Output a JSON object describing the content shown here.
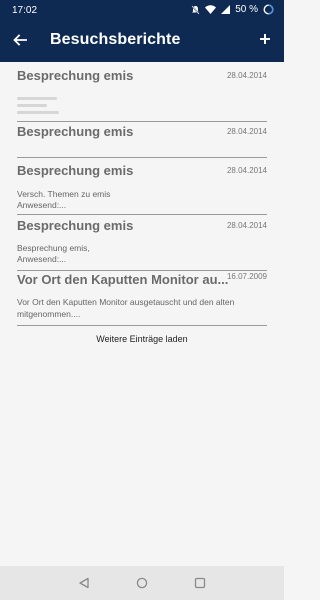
{
  "status_bar": {
    "time": "17:02",
    "battery": "50 %"
  },
  "app_bar": {
    "title": "Besuchsberichte",
    "back_icon": "arrow-left-icon",
    "add_icon": "plus-icon"
  },
  "reports": [
    {
      "title": "Besprechung emis",
      "date": "28.04.2014",
      "description_line1": "",
      "description_line2": ""
    },
    {
      "title": "Besprechung emis",
      "date": "28.04.2014",
      "description_line1": "",
      "description_line2": ""
    },
    {
      "title": "Besprechung emis",
      "date": "28.04.2014",
      "description_line1": "Versch. Themen zu emis",
      "description_line2": "Anwesend:..."
    },
    {
      "title": "Besprechung emis",
      "date": "28.04.2014",
      "description_line1": "Besprechung emis,",
      "description_line2": "Anwesend:..."
    },
    {
      "title": "Vor Ort den Kaputten Monitor au...",
      "date": "16.07.2009",
      "description_line1": "Vor Ort den Kaputten Monitor ausgetauscht und den alten",
      "description_line2": "mitgenommen...."
    }
  ],
  "load_more_label": "Weitere Einträge laden",
  "colors": {
    "app_bar": "#0e2a52",
    "background": "#f5f5f5",
    "nav_bar": "#e6e6e6"
  }
}
